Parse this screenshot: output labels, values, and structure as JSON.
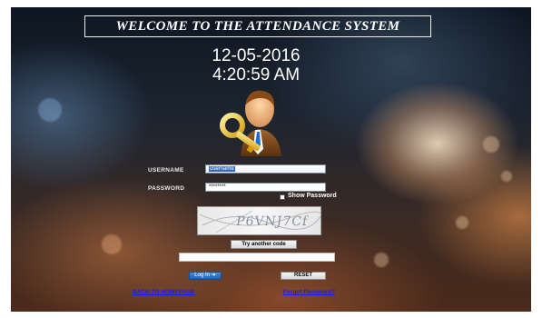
{
  "header": {
    "title": "WELCOME TO THE ATTENDANCE SYSTEM"
  },
  "clock": {
    "date": "12-05-2016",
    "time": "4:20:59 AM"
  },
  "form": {
    "username_label": "USERNAME",
    "username_value": "username",
    "password_label": "PASSWORD",
    "password_value": "********",
    "show_password_label": "Show Password",
    "captcha_text": "P6VNJ7Cf",
    "try_another_label": "Try another code",
    "captcha_input_value": "",
    "login_label": "Log In",
    "reset_label": "RESET",
    "back_link": "BACK TO HOMEPAGE",
    "forgot_link": "Forgot Password?"
  },
  "colors": {
    "link_blue": "#1a1aff",
    "login_button": "#2f6fc0",
    "selection": "#3366cc"
  }
}
